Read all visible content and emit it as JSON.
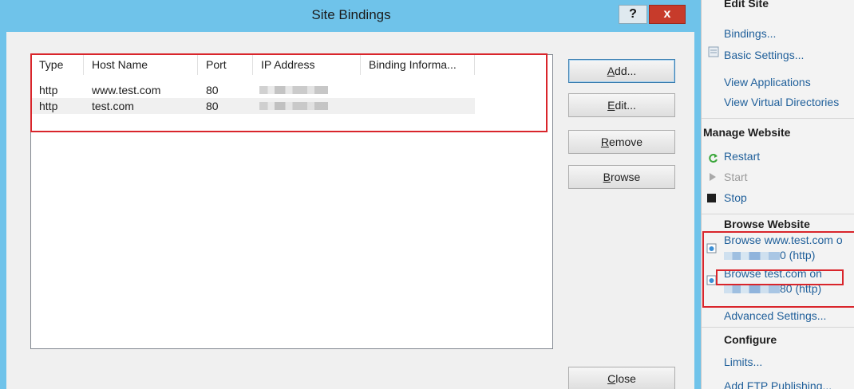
{
  "dialog": {
    "title": "Site Bindings",
    "help_label": "?",
    "close_label": "x",
    "columns": [
      "Type",
      "Host Name",
      "Port",
      "IP Address",
      "Binding Informa..."
    ],
    "rows": [
      {
        "type": "http",
        "host": "www.test.com",
        "port": "80",
        "ip": "",
        "binding": ""
      },
      {
        "type": "http",
        "host": "test.com",
        "port": "80",
        "ip": "",
        "binding": ""
      }
    ],
    "buttons": {
      "add": {
        "key": "A",
        "rest": "dd..."
      },
      "edit": {
        "key": "E",
        "rest": "dit..."
      },
      "remove": {
        "key": "R",
        "rest": "emove"
      },
      "browse": {
        "key": "B",
        "rest": "rowse"
      },
      "close": {
        "key": "C",
        "rest": "lose"
      }
    }
  },
  "actions": {
    "edit_site": {
      "heading": "Edit Site",
      "bindings": "Bindings...",
      "basic_settings": "Basic Settings...",
      "view_applications": "View Applications",
      "view_virtual_directories": "View Virtual Directories"
    },
    "manage_website": {
      "heading": "Manage Website",
      "restart": "Restart",
      "start": "Start",
      "stop": "Stop"
    },
    "browse_website": {
      "heading": "Browse Website",
      "browse_www_line1": "Browse www.test.com o",
      "browse_www_line2": "0 (http)",
      "browse_test_line1": "Browse test.com on",
      "browse_test_line2": "80 (http)"
    },
    "advanced_settings": "Advanced Settings...",
    "configure": {
      "heading": "Configure",
      "limits": "Limits...",
      "add_ftp": "Add FTP Publishing..."
    }
  },
  "colors": {
    "title_bar": "#6fc3ea",
    "highlight_box": "#d9252b",
    "link": "#1f5f9a",
    "close_button": "#c73b2b"
  },
  "icons": [
    "help-icon",
    "close-icon",
    "settings-icon",
    "restart-icon",
    "start-icon",
    "stop-icon",
    "browse-page-icon"
  ]
}
